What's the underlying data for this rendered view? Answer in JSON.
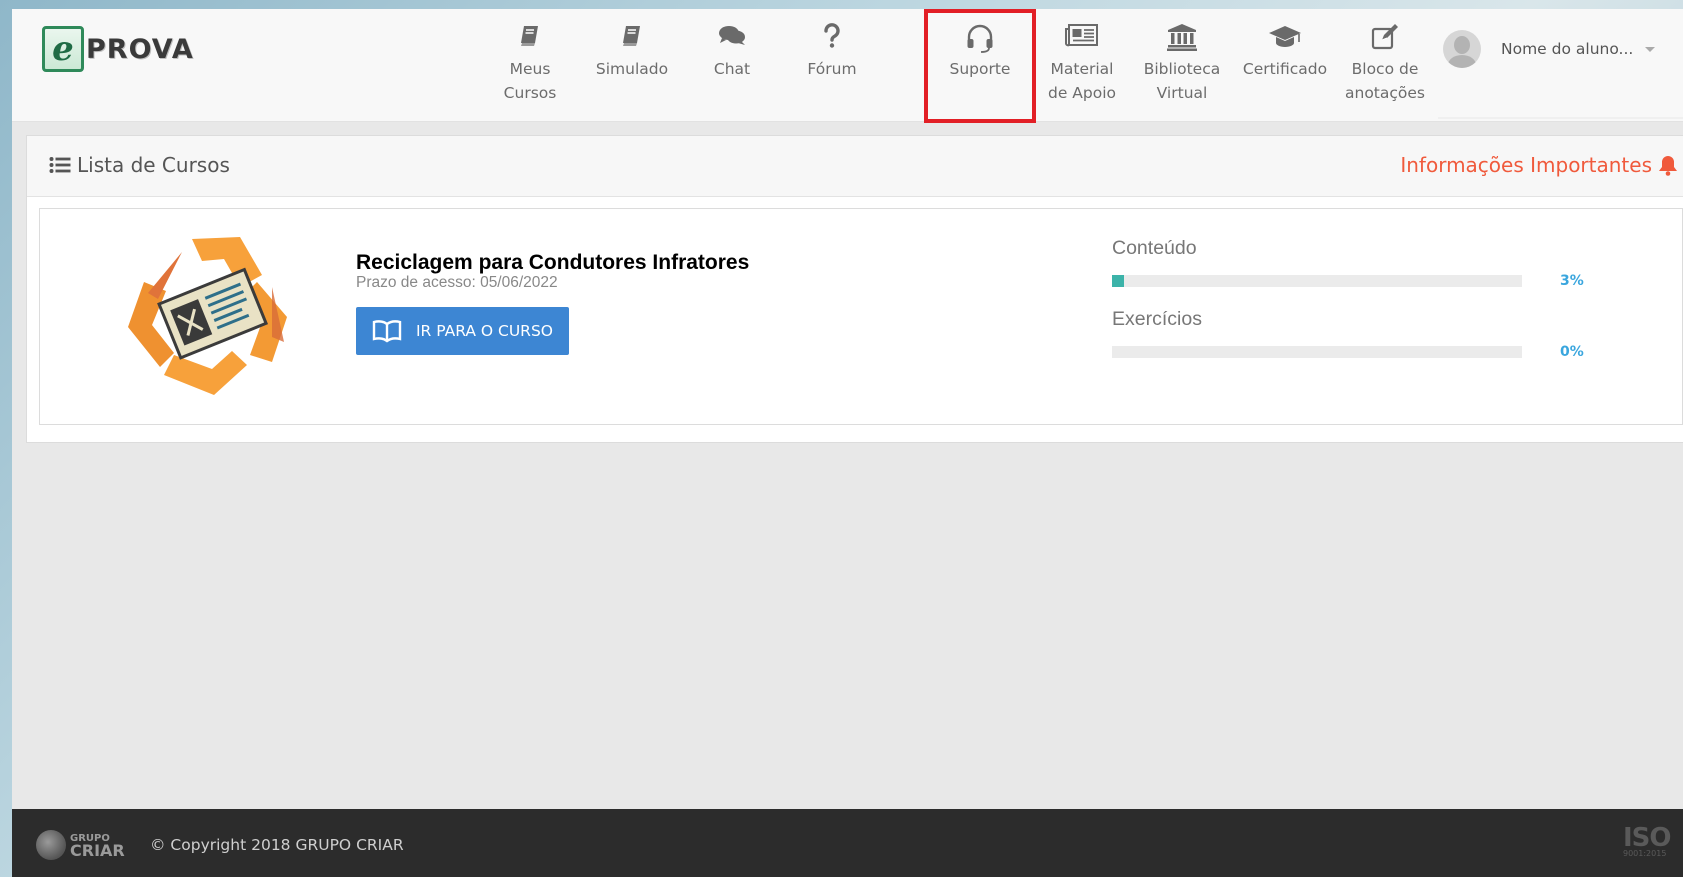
{
  "header": {
    "logo_text": "PROVA",
    "logo_mark": "e",
    "nav": [
      {
        "label": "Meus\nCursos",
        "icon": "book-icon"
      },
      {
        "label": "Simulado",
        "icon": "book-icon"
      },
      {
        "label": "Chat",
        "icon": "chat-icon"
      },
      {
        "label": "Fórum",
        "icon": "question-icon"
      },
      {
        "label": "Suporte",
        "icon": "headset-icon",
        "active": true
      },
      {
        "label": "Material\nde Apoio",
        "icon": "newspaper-icon"
      },
      {
        "label": "Biblioteca\nVirtual",
        "icon": "library-icon"
      },
      {
        "label": "Certificado",
        "icon": "graduation-cap-icon"
      },
      {
        "label": "Bloco de\nanotações",
        "icon": "edit-icon"
      }
    ],
    "user_name": "Nome do aluno..."
  },
  "panel": {
    "title": "Lista de Cursos",
    "info_link": "Informações Importantes"
  },
  "course": {
    "name": "Reciclagem para Condutores Infratores",
    "access": "Prazo de acesso: 05/06/2022",
    "button_label": "IR PARA O CURSO",
    "progress": [
      {
        "label": "Conteúdo",
        "percent": 3,
        "percent_text": "3%"
      },
      {
        "label": "Exercícios",
        "percent": 0,
        "percent_text": "0%"
      }
    ]
  },
  "footer": {
    "logo_small": "GRUPO",
    "logo_big": "CRIAR",
    "copyright": "© Copyright 2018 GRUPO CRIAR",
    "iso_text": "ISO",
    "iso_number": "9001:2015"
  },
  "colors": {
    "accent_blue": "#3d86d3",
    "progress_teal": "#3cb3a9",
    "info_red": "#f05a3c",
    "highlight_red": "#e21f26"
  }
}
